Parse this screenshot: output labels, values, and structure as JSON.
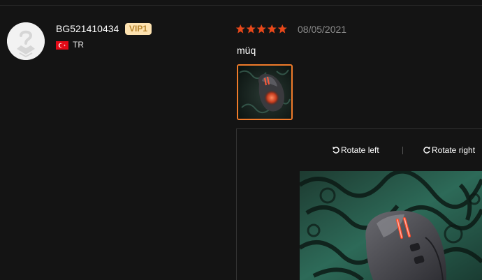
{
  "review": {
    "user": {
      "name": "BG521410434",
      "badge": "VIP1",
      "country": "TR",
      "flag_icon": "turkey-flag-icon",
      "avatar_icon": "default-avatar-icon"
    },
    "rating": 5,
    "rating_max": 5,
    "date": "08/05/2021",
    "text": "müq",
    "photo_count": 1
  },
  "viewer": {
    "rotate_left_label": "Rotate left",
    "rotate_right_label": "Rotate right"
  },
  "colors": {
    "background": "#141414",
    "star": "#e8481a",
    "thumb_border": "#f07b2a",
    "vip_bg": "#fde2b0",
    "vip_text": "#b8862e",
    "date_text": "#8c8c8c"
  }
}
